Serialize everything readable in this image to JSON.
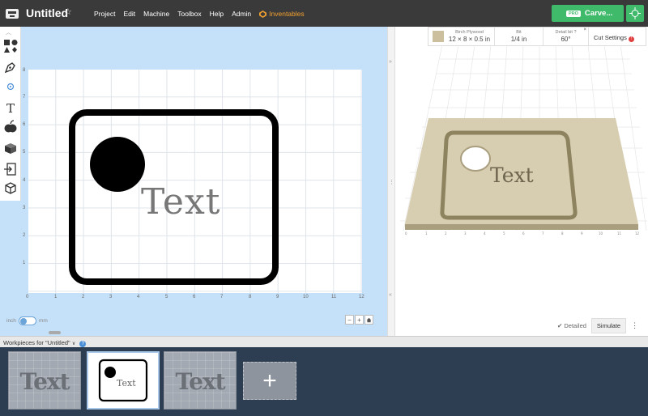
{
  "app": {
    "title": "Untitled",
    "star_icon": "star-outline-icon"
  },
  "menu": {
    "items": [
      "Project",
      "Edit",
      "Machine",
      "Toolbox",
      "Help",
      "Admin"
    ],
    "inventables": "Inventables"
  },
  "carve": {
    "pro_label": "PRO",
    "label": "Carve..."
  },
  "canvas": {
    "x_ticks": [
      "0",
      "1",
      "2",
      "3",
      "4",
      "5",
      "6",
      "7",
      "8",
      "9",
      "10",
      "11",
      "12"
    ],
    "y_ticks": [
      "1",
      "2",
      "3",
      "4",
      "5",
      "6",
      "7",
      "8"
    ],
    "design_text": "Text",
    "units_left": "inch",
    "units_right": "mm"
  },
  "material": {
    "name_label": "Birch Plywood",
    "size": "12 × 8 × 0.5 in",
    "bit_label": "Bit",
    "bit_value": "1/4 in",
    "detail_label": "Detail bit",
    "detail_value": "60°",
    "cut_settings": "Cut Settings",
    "swatch_color": "#cbbf9e"
  },
  "preview": {
    "text": "Text",
    "detailed_label": "Detailed",
    "simulate_label": "Simulate"
  },
  "workpieces": {
    "header": "Workpieces for \"Untitled\"",
    "items": [
      {
        "label": "Text"
      },
      {
        "label": "Text"
      },
      {
        "label": "Text"
      }
    ]
  }
}
